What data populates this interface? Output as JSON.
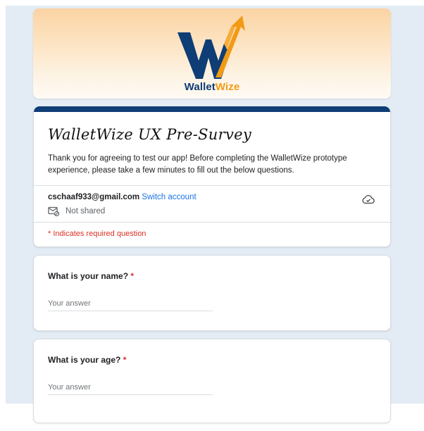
{
  "header": {
    "brand_part1": "Wallet",
    "brand_part2": "Wize"
  },
  "form": {
    "title": "WalletWize UX Pre-Survey",
    "description": "Thank you for agreeing to test our app! Before completing the WalletWize prototype experience, please take a few minutes to fill out the below questions."
  },
  "account": {
    "email": "cschaaf933@gmail.com",
    "switch_label": "Switch account",
    "sharing_status": "Not shared",
    "sync_icon": "cloud-done-icon",
    "sharing_icon": "mail-lock-icon"
  },
  "required_note": "* Indicates required question",
  "questions": [
    {
      "label": "What is your name?",
      "required_mark": "*",
      "placeholder": "Your answer"
    },
    {
      "label": "What is your age?",
      "required_mark": "*",
      "placeholder": "Your answer"
    }
  ],
  "colors": {
    "brand_navy": "#0f3d75",
    "brand_orange": "#f29a14",
    "link_blue": "#1a73e8",
    "required_red": "#d93025",
    "page_background": "#e3ebf4"
  }
}
